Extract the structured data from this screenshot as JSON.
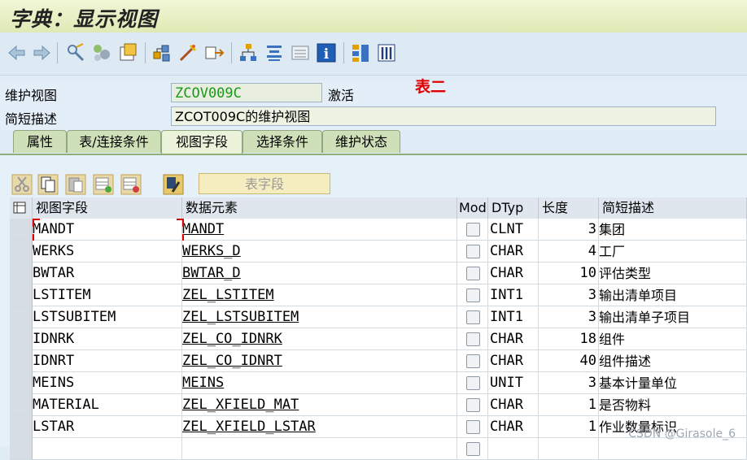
{
  "window": {
    "title": "字典：显示视图"
  },
  "toolbar_icons": [
    "back-arrow-icon",
    "forward-arrow-icon",
    "display-change-icon",
    "other-object-icon",
    "activate-icon",
    "check-icon",
    "test-icon",
    "where-used-icon",
    "navigate-icon",
    "object-list-icon",
    "info-icon",
    "technical-settings-icon",
    "layout-icon"
  ],
  "form": {
    "view_label": "维护视图",
    "view_value": "ZCOV009C",
    "status": "激活",
    "desc_label": "简短描述",
    "desc_value": "ZCOT009C的维护视图",
    "annotation": "表二"
  },
  "tabs": [
    {
      "label": "属性",
      "active": false
    },
    {
      "label": "表/连接条件",
      "active": false
    },
    {
      "label": "视图字段",
      "active": true
    },
    {
      "label": "选择条件",
      "active": false
    },
    {
      "label": "维护状态",
      "active": false
    }
  ],
  "table_toolbar": {
    "table_fields_button": "表字段"
  },
  "table": {
    "headers": {
      "view_field": "视图字段",
      "data_element": "数据元素",
      "mod": "Mod",
      "dtyp": "DTyp",
      "length": "长度",
      "short_desc": "简短描述"
    },
    "rows": [
      {
        "field": "MANDT",
        "element": "MANDT",
        "dtyp": "CLNT",
        "length": "3",
        "desc": "集团"
      },
      {
        "field": "WERKS",
        "element": "WERKS_D",
        "dtyp": "CHAR",
        "length": "4",
        "desc": "工厂"
      },
      {
        "field": "BWTAR",
        "element": "BWTAR_D",
        "dtyp": "CHAR",
        "length": "10",
        "desc": "评估类型"
      },
      {
        "field": "LSTITEM",
        "element": "ZEL_LSTITEM",
        "dtyp": "INT1",
        "length": "3",
        "desc": "输出清单项目"
      },
      {
        "field": "LSTSUBITEM",
        "element": "ZEL_LSTSUBITEM",
        "dtyp": "INT1",
        "length": "3",
        "desc": "输出清单子项目"
      },
      {
        "field": "IDNRK",
        "element": "ZEL_CO_IDNRK",
        "dtyp": "CHAR",
        "length": "18",
        "desc": "组件"
      },
      {
        "field": "IDNRT",
        "element": "ZEL_CO_IDNRT",
        "dtyp": "CHAR",
        "length": "40",
        "desc": "组件描述"
      },
      {
        "field": "MEINS",
        "element": "MEINS",
        "dtyp": "UNIT",
        "length": "3",
        "desc": "基本计量单位"
      },
      {
        "field": "MATERIAL",
        "element": "ZEL_XFIELD_MAT",
        "dtyp": "CHAR",
        "length": "1",
        "desc": "是否物料"
      },
      {
        "field": "LSTAR",
        "element": "ZEL_XFIELD_LSTAR",
        "dtyp": "CHAR",
        "length": "1",
        "desc": "作业数量标识"
      },
      {
        "field": "",
        "element": "",
        "dtyp": "",
        "length": "",
        "desc": ""
      }
    ]
  },
  "watermark": "CSDN @Girasole_6"
}
